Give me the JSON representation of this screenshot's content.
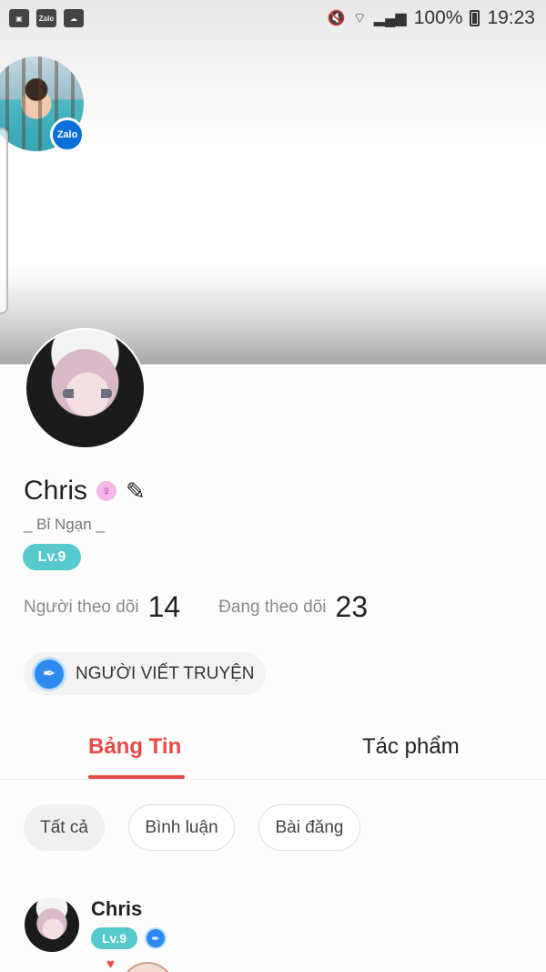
{
  "status_bar": {
    "app_icons": [
      "gallery-icon",
      "zalo-icon",
      "zalo-cloud-icon"
    ],
    "zalo_label": "Zalo",
    "battery": "100%",
    "time": "19:23"
  },
  "floating": {
    "badge": "Zalo"
  },
  "profile": {
    "name": "Chris",
    "bio": "_ Bỉ Ngạn _",
    "level": "Lv.9",
    "followers_label": "Người theo dõi",
    "followers_count": "14",
    "following_label": "Đang theo dõi",
    "following_count": "23",
    "writer_label": "NGƯỜI VIẾT TRUYỆN"
  },
  "tabs": [
    {
      "label": "Bảng Tin",
      "active": true
    },
    {
      "label": "Tác phẩm",
      "active": false
    }
  ],
  "filters": [
    {
      "label": "Tất cả",
      "active": true
    },
    {
      "label": "Bình luận",
      "active": false
    },
    {
      "label": "Bài đăng",
      "active": false
    }
  ],
  "post": {
    "author": "Chris",
    "level": "Lv.9"
  },
  "colors": {
    "accent": "#e64a45",
    "level_badge": "#55c9cb",
    "writer_icon": "#2f8af0",
    "zalo": "#0a6fd8"
  }
}
